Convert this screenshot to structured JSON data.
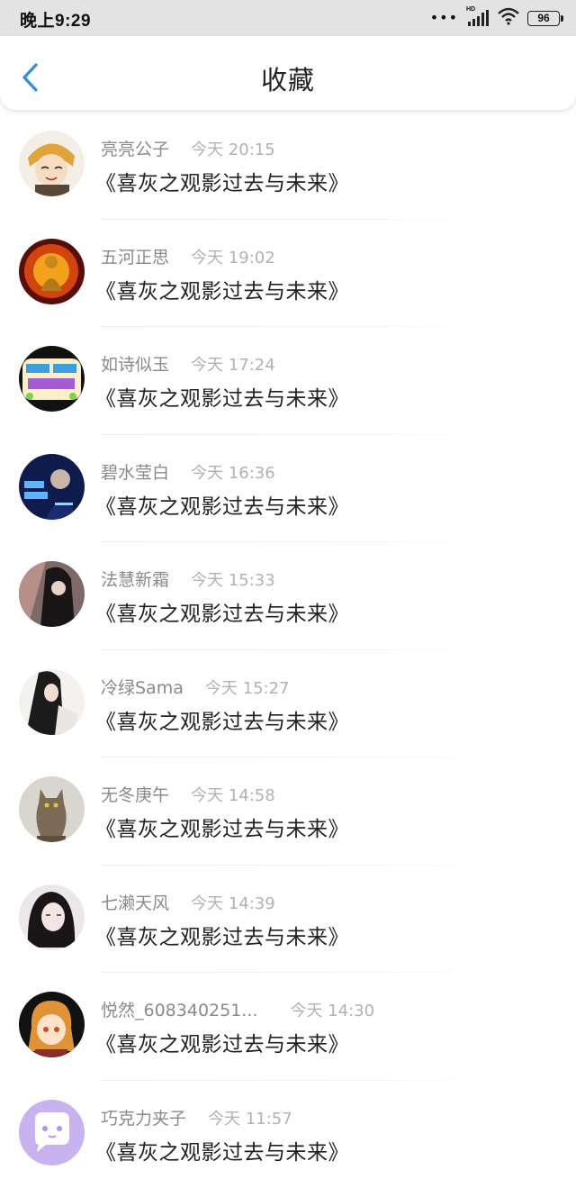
{
  "status_bar": {
    "time": "晚上9:29",
    "network": "HD",
    "battery": "96"
  },
  "header": {
    "title": "收藏"
  },
  "favorites": [
    {
      "user": "亮亮公子",
      "time": "今天 20:15",
      "title": "《喜灰之观影过去与未来》"
    },
    {
      "user": "五河正思",
      "time": "今天 19:02",
      "title": "《喜灰之观影过去与未来》"
    },
    {
      "user": "如诗似玉",
      "time": "今天 17:24",
      "title": "《喜灰之观影过去与未来》"
    },
    {
      "user": "碧水莹白",
      "time": "今天 16:36",
      "title": "《喜灰之观影过去与未来》"
    },
    {
      "user": "法慧新霜",
      "time": "今天 15:33",
      "title": "《喜灰之观影过去与未来》"
    },
    {
      "user": "冷绿Sama",
      "time": "今天 15:27",
      "title": "《喜灰之观影过去与未来》"
    },
    {
      "user": "无冬庚午",
      "time": "今天 14:58",
      "title": "《喜灰之观影过去与未来》"
    },
    {
      "user": "七濑天风",
      "time": "今天 14:39",
      "title": "《喜灰之观影过去与未来》"
    },
    {
      "user": "悦然_608340251...",
      "time": "今天 14:30",
      "title": "《喜灰之观影过去与未来》"
    },
    {
      "user": "巧克力夹子",
      "time": "今天 11:57",
      "title": "《喜灰之观影过去与未来》"
    }
  ],
  "colors": {
    "accent": "#2f8de4",
    "status_bar_bg": "#e3e3e3",
    "username": "#8a8a8a",
    "timestamp": "#b2b2b2",
    "title_text": "#222222"
  }
}
